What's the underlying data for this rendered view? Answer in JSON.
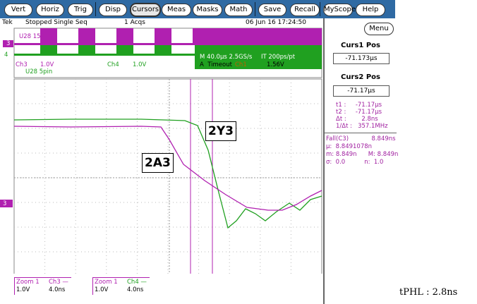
{
  "toolbar": {
    "buttons": [
      "Vert",
      "Horiz",
      "Trig",
      "Disp",
      "Cursors",
      "Meas",
      "Masks",
      "Math",
      "Save",
      "Recall",
      "MyScope",
      "Help"
    ],
    "selected": "Cursors"
  },
  "status": {
    "brand": "Tek",
    "state": "Stopped  Single Seq",
    "acqs": "1 Acqs",
    "datetime": "06 Jun 16 17:24:50"
  },
  "overview": {
    "ch3_marker": "3",
    "ch4_marker": "4",
    "label_u28_15": "U28 15",
    "ch3": "Ch3",
    "ch3_scale": "1.0V",
    "ch4": "Ch4",
    "ch4_scale": "1.0V",
    "u28_5": "U28 5pin",
    "timebase": "M 40.0μs 2.5GS/s",
    "interp": "IT 200ps/pt",
    "trigger_mode": "A  Timeout",
    "trigger_ch": "Ch1",
    "trigger_level": "1.56V"
  },
  "plot": {
    "ch3_marker": "3",
    "label_y": "2Y3",
    "label_a": "2A3",
    "colors": {
      "ch3": "#b020b0",
      "ch4": "#20a020"
    }
  },
  "footer": {
    "z1": "Zoom 1",
    "z1ch": "Ch3 —",
    "z1v": "1.0V",
    "z1t": "4.0ns",
    "z2": "Zoom 1",
    "z2ch": "Ch4 —",
    "z2v": "1.0V",
    "z2t": "4.0ns"
  },
  "panel": {
    "menu": "Menu",
    "curs1_title": "Curs1 Pos",
    "curs1_value": "-71.173μs",
    "curs2_title": "Curs2 Pos",
    "curs2_value": "-71.17μs",
    "readout": [
      "t1 :     -71.17μs",
      "t2 :     -71.17μs",
      "Δt :        2.8ns",
      "1/Δt :   357.1MHz"
    ],
    "meas": [
      "Fall(C3)            8.849ns",
      "μ:  8.8491078n",
      "m: 8.849n      M: 8.849n",
      "σ:  0.0          n:  1.0"
    ]
  },
  "annotation": "tPHL : 2.8ns"
}
